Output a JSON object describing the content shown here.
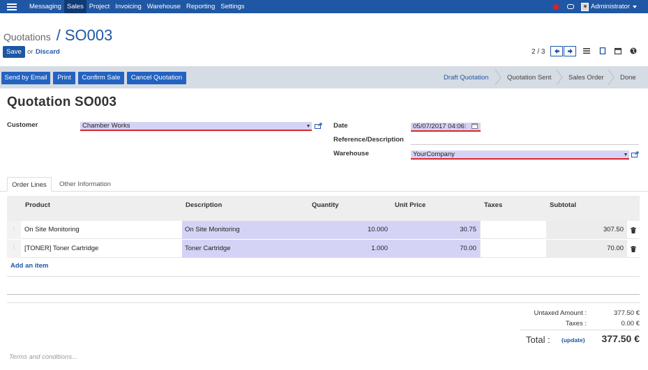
{
  "topbar": {
    "menu": [
      "Messaging",
      "Sales",
      "Project",
      "Invoicing",
      "Warehouse",
      "Reporting",
      "Settings"
    ],
    "active": "Sales",
    "user": "Administrator"
  },
  "breadcrumb": {
    "parent": "Quotations",
    "sep": "/",
    "current": "SO003"
  },
  "buttons": {
    "save": "Save",
    "or": "or",
    "discard": "Discard"
  },
  "pager": {
    "text": "2 / 3"
  },
  "actions": {
    "send_email": "Send by Email",
    "print": "Print",
    "confirm": "Confirm Sale",
    "cancel": "Cancel Quotation"
  },
  "statusbar": [
    "Draft Quotation",
    "Quotation Sent",
    "Sales Order",
    "Done"
  ],
  "form": {
    "title": "Quotation SO003",
    "customer_label": "Customer",
    "customer_value": "Chamber Works",
    "date_label": "Date",
    "date_value": "05/07/2017 04:06:",
    "reference_label": "Reference/Description",
    "reference_value": "",
    "warehouse_label": "Warehouse",
    "warehouse_value": "YourCompany"
  },
  "tabs": [
    "Order Lines",
    "Other Information"
  ],
  "table": {
    "headers": [
      "Product",
      "Description",
      "Quantity",
      "Unit Price",
      "Taxes",
      "Subtotal"
    ],
    "rows": [
      {
        "product": "On Site Monitoring",
        "description": "On Site Monitoring",
        "quantity": "10.000",
        "unit_price": "30.75",
        "taxes": "",
        "subtotal": "307.50"
      },
      {
        "product": "[TONER] Toner Cartridge",
        "description": "Toner Cartridge",
        "quantity": "1.000",
        "unit_price": "70.00",
        "taxes": "",
        "subtotal": "70.00"
      }
    ],
    "add_item": "Add an item"
  },
  "totals": {
    "untaxed_label": "Untaxed Amount :",
    "untaxed_value": "377.50 €",
    "taxes_label": "Taxes :",
    "taxes_value": "0.00 €",
    "total_label": "Total :",
    "update_label": "(update)",
    "total_value": "377.50 €"
  },
  "terms_placeholder": "Terms and conditions...",
  "colors": {
    "brand": "#1f57a4",
    "button": "#2363c1",
    "field_bg": "#d5d3f5",
    "required_underline": "#d8262c"
  }
}
